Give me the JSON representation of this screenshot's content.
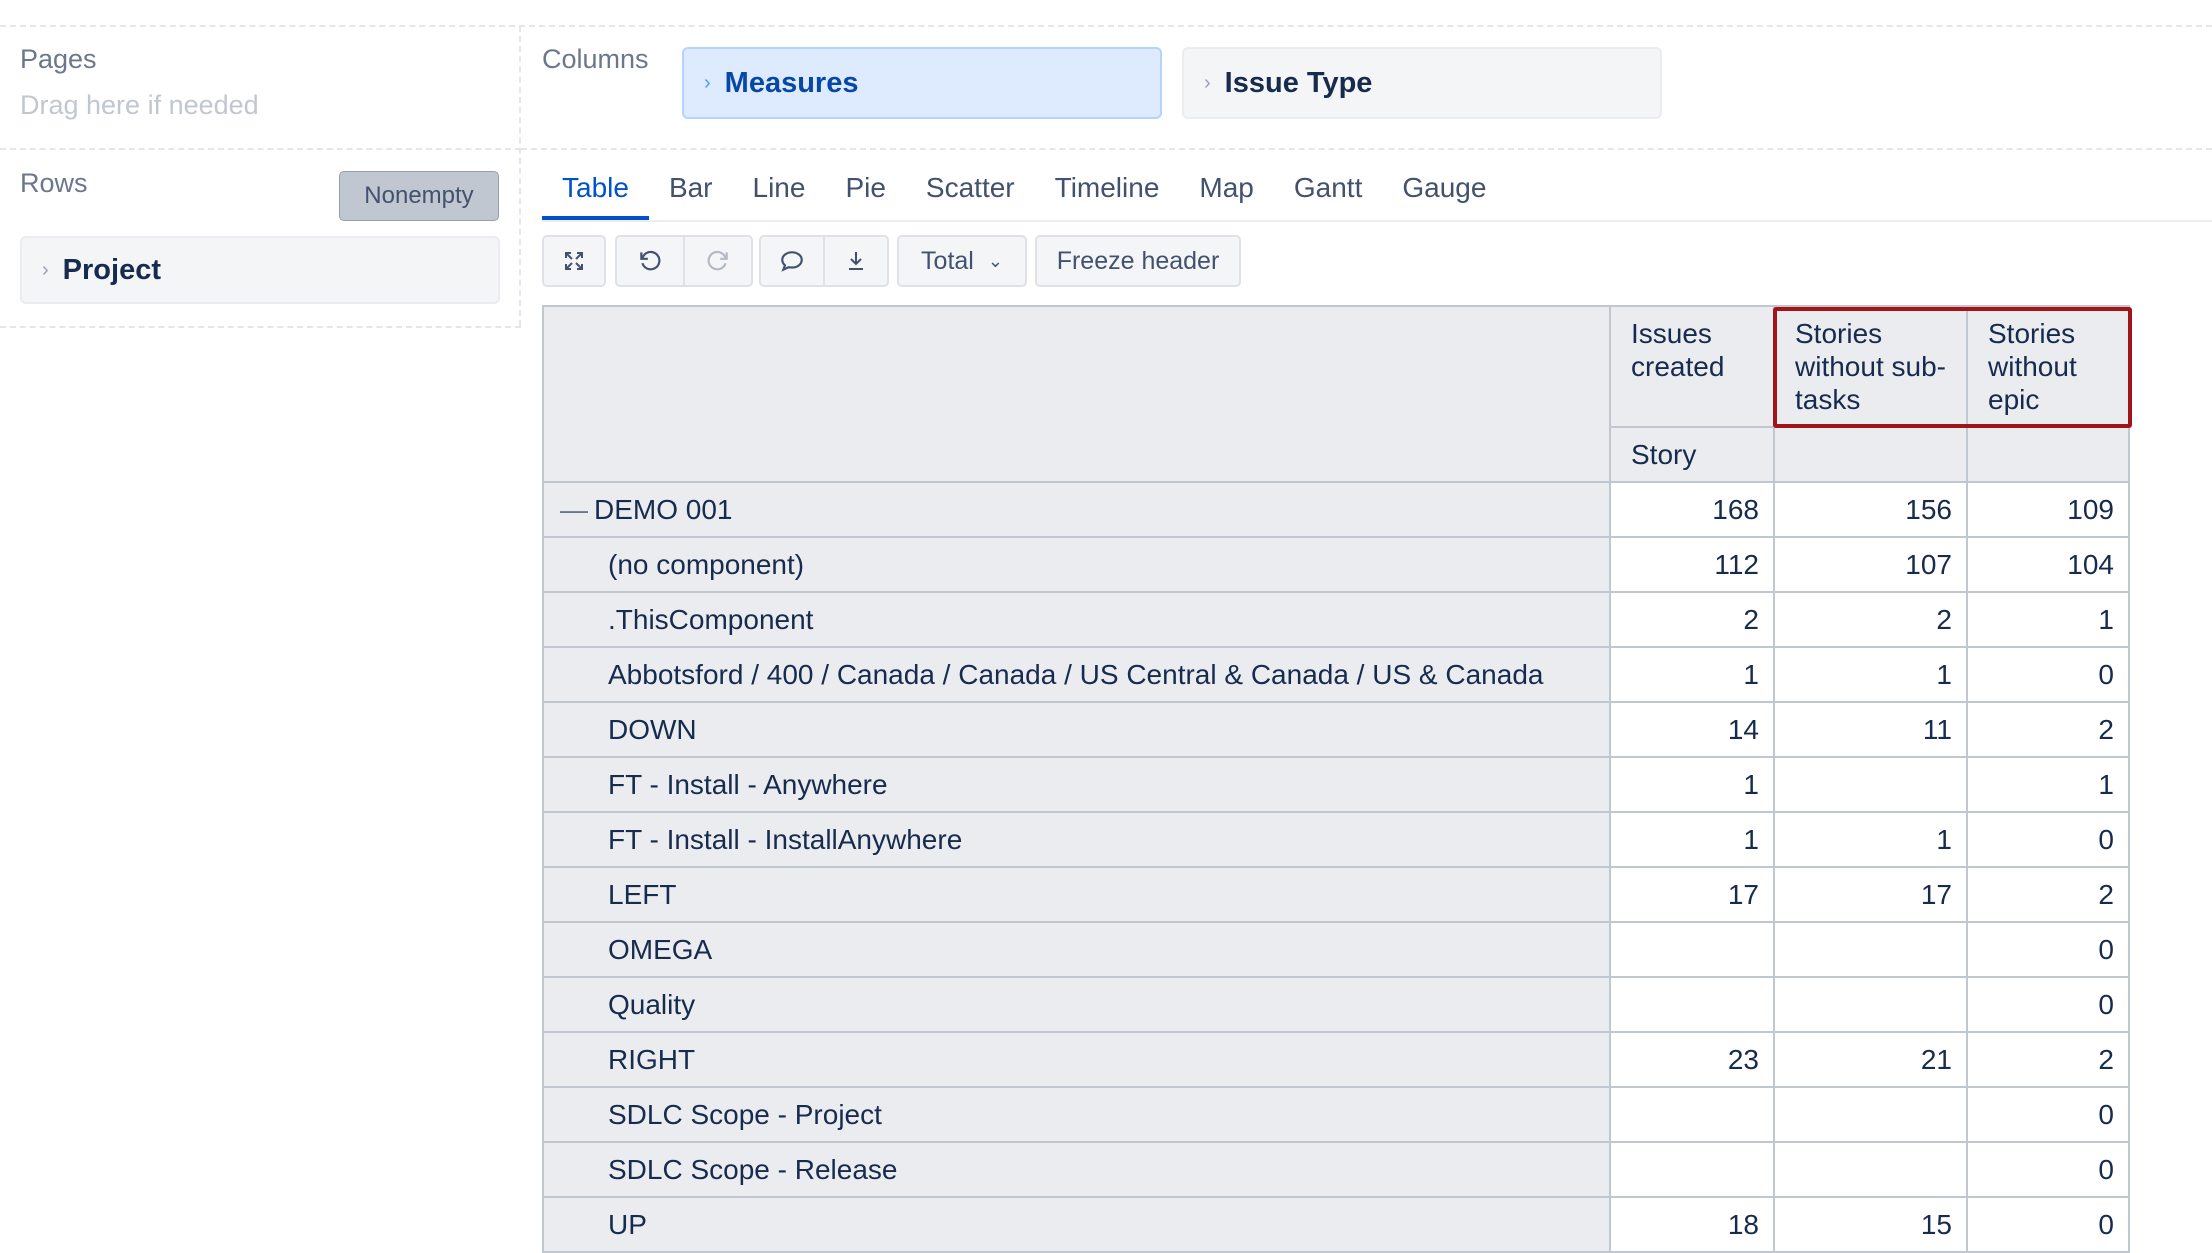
{
  "pages": {
    "title": "Pages",
    "hint": "Drag here if needed"
  },
  "rows": {
    "title": "Rows",
    "nonempty_label": "Nonempty",
    "dimension": "Project"
  },
  "columns": {
    "title": "Columns",
    "dimensions": [
      "Measures",
      "Issue Type"
    ]
  },
  "tabs": [
    "Table",
    "Bar",
    "Line",
    "Pie",
    "Scatter",
    "Timeline",
    "Map",
    "Gantt",
    "Gauge"
  ],
  "active_tab": "Table",
  "toolbar": {
    "icons": [
      "expand-icon",
      "undo-icon",
      "redo-icon",
      "comment-icon",
      "download-icon"
    ],
    "total_label": "Total",
    "freeze_label": "Freeze header"
  },
  "table": {
    "headers": [
      "Issues created",
      "Stories without sub-tasks",
      "Stories without epic"
    ],
    "subheaders": [
      "Story",
      "",
      ""
    ],
    "rows": [
      {
        "label": "DEMO 001",
        "values": [
          "168",
          "156",
          "109"
        ]
      },
      {
        "label": "(no component)",
        "values": [
          "112",
          "107",
          "104"
        ]
      },
      {
        "label": ".ThisComponent",
        "values": [
          "2",
          "2",
          "1"
        ]
      },
      {
        "label": "Abbotsford / 400 / Canada / Canada / US Central & Canada / US & Canada",
        "values": [
          "1",
          "1",
          "0"
        ]
      },
      {
        "label": "DOWN",
        "values": [
          "14",
          "11",
          "2"
        ]
      },
      {
        "label": "FT - Install - Anywhere",
        "values": [
          "1",
          "",
          "1"
        ]
      },
      {
        "label": "FT - Install - InstallAnywhere",
        "values": [
          "1",
          "1",
          "0"
        ]
      },
      {
        "label": "LEFT",
        "values": [
          "17",
          "17",
          "2"
        ]
      },
      {
        "label": "OMEGA",
        "values": [
          "",
          "",
          "0"
        ]
      },
      {
        "label": "Quality",
        "values": [
          "",
          "",
          "0"
        ]
      },
      {
        "label": "RIGHT",
        "values": [
          "23",
          "21",
          "2"
        ]
      },
      {
        "label": "SDLC Scope - Project",
        "values": [
          "",
          "",
          "0"
        ]
      },
      {
        "label": "SDLC Scope - Release",
        "values": [
          "",
          "",
          "0"
        ]
      },
      {
        "label": "UP",
        "values": [
          "18",
          "15",
          "0"
        ]
      }
    ]
  },
  "colors": {
    "accent": "#0052cc",
    "highlight": "#a0141a",
    "header_bg": "#ebecf0"
  }
}
